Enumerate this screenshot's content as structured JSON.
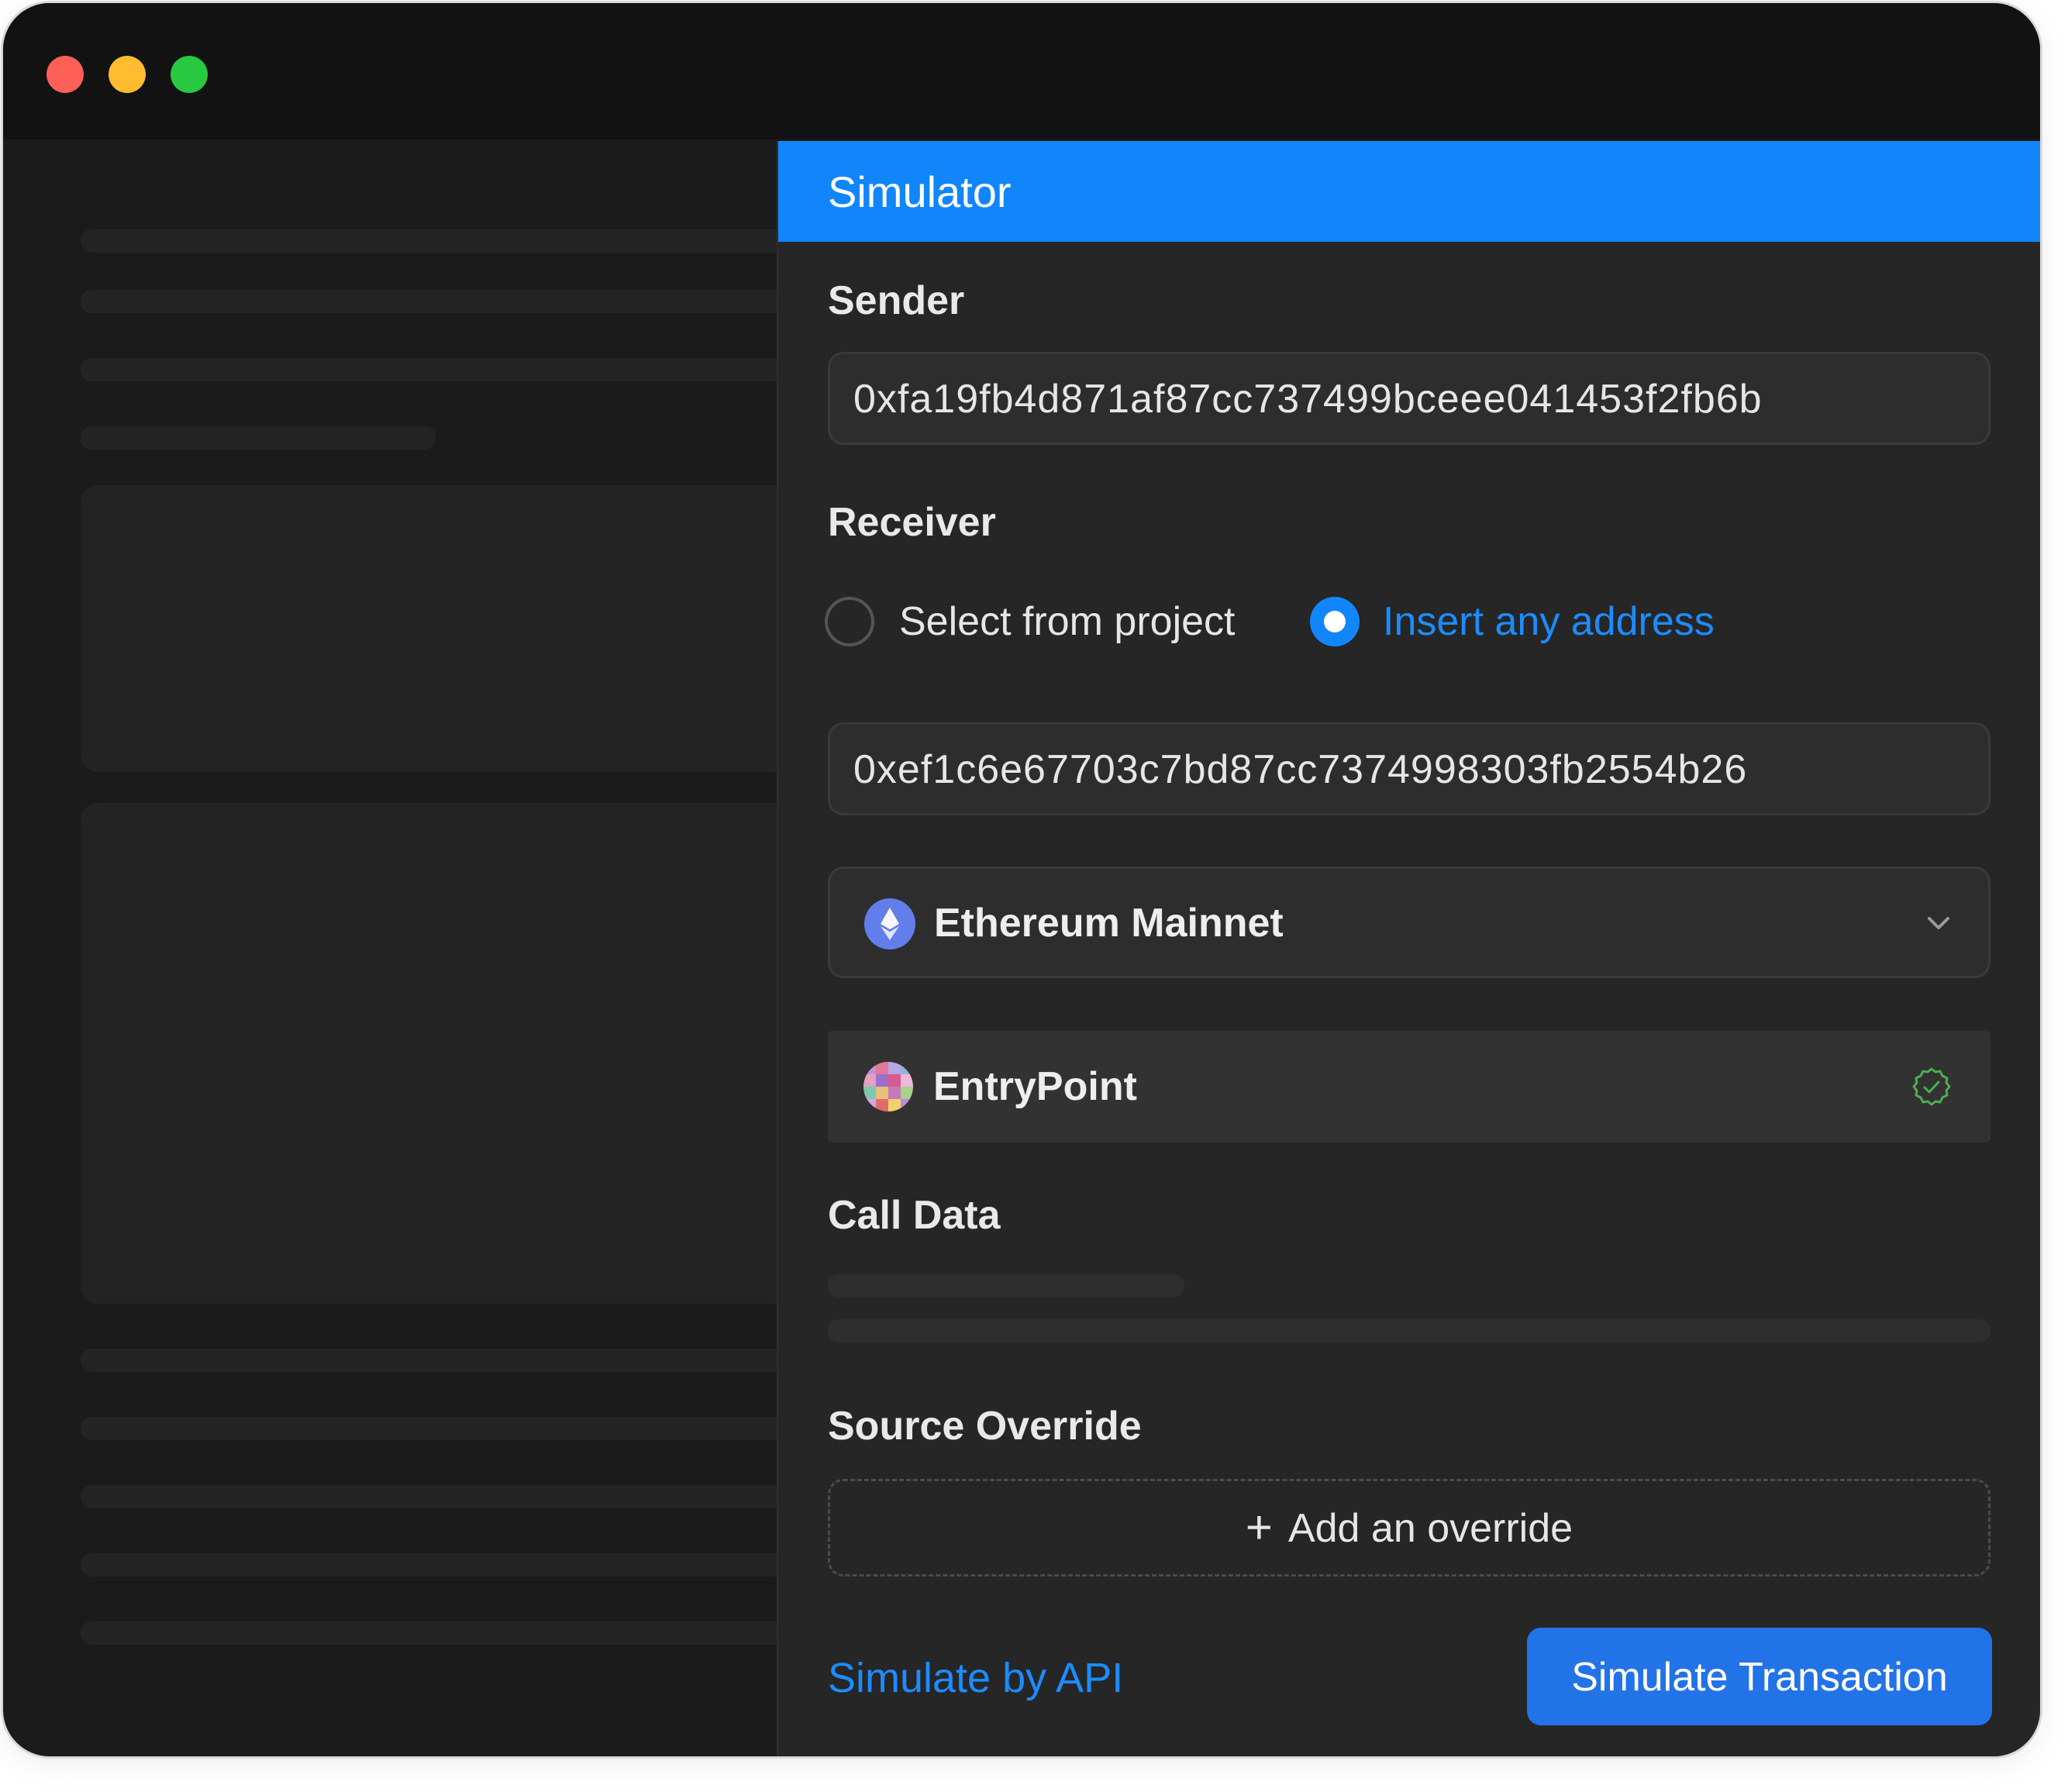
{
  "window": {
    "controls": [
      "close",
      "minimize",
      "maximize"
    ]
  },
  "simulator": {
    "title": "Simulator",
    "sender": {
      "label": "Sender",
      "value": "0xfa19fb4d871af87cc737499bceee041453f2fb6b"
    },
    "receiver": {
      "label": "Receiver",
      "options": [
        {
          "label": "Select from project",
          "selected": false
        },
        {
          "label": "Insert any address",
          "selected": true
        }
      ],
      "value": "0xef1c6e67703c7bd87cc7374998303fb2554b26"
    },
    "network": {
      "value": "Ethereum Mainnet",
      "icon": "ethereum-icon"
    },
    "contract": {
      "name": "EntryPoint",
      "icon": "contract-avatar",
      "status_icon": "verified-check-icon"
    },
    "call_data": {
      "label": "Call Data"
    },
    "source_override": {
      "label": "Source Override",
      "add_label": "Add an override"
    },
    "footer": {
      "api_link": "Simulate by API",
      "submit_label": "Simulate Transaction"
    }
  },
  "colors": {
    "accent": "#1186fa",
    "button": "#2373e8",
    "link": "#1c8cff",
    "verified": "#4caf50"
  }
}
